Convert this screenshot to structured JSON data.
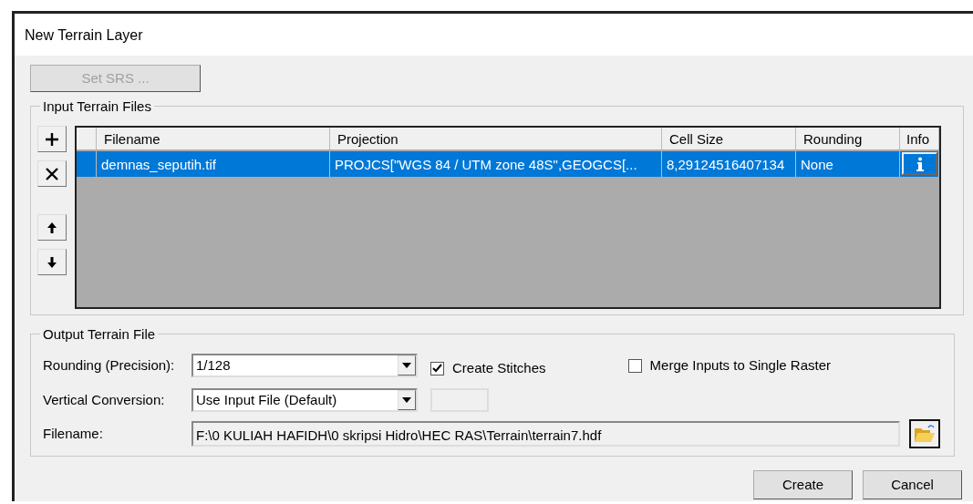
{
  "window": {
    "title": "New Terrain Layer"
  },
  "set_srs_button": {
    "label": "Set SRS ...",
    "disabled": true
  },
  "input_group": {
    "title": "Input Terrain Files",
    "table": {
      "columns": [
        "Filename",
        "Projection",
        "Cell Size",
        "Rounding",
        "Info"
      ],
      "rows": [
        {
          "filename": "demnas_seputih.tif",
          "projection": "PROJCS[\"WGS 84 / UTM zone 48S\",GEOGCS[...",
          "cell_size": "8,29124516407134",
          "rounding": "None",
          "selected": true
        }
      ]
    }
  },
  "output_group": {
    "title": "Output Terrain File",
    "rounding": {
      "label": "Rounding (Precision):",
      "value": "1/128"
    },
    "vertical_conversion": {
      "label": "Vertical Conversion:",
      "value": "Use Input File (Default)"
    },
    "filename": {
      "label": "Filename:",
      "value": "F:\\0 KULIAH HAFIDH\\0 skripsi Hidro\\HEC RAS\\Terrain\\terrain7.hdf"
    },
    "checkboxes": [
      {
        "label": "Create Stitches",
        "checked": true
      },
      {
        "label": "Merge Inputs to Single Raster",
        "checked": false
      }
    ]
  },
  "buttons": [
    "Create",
    "Cancel"
  ]
}
